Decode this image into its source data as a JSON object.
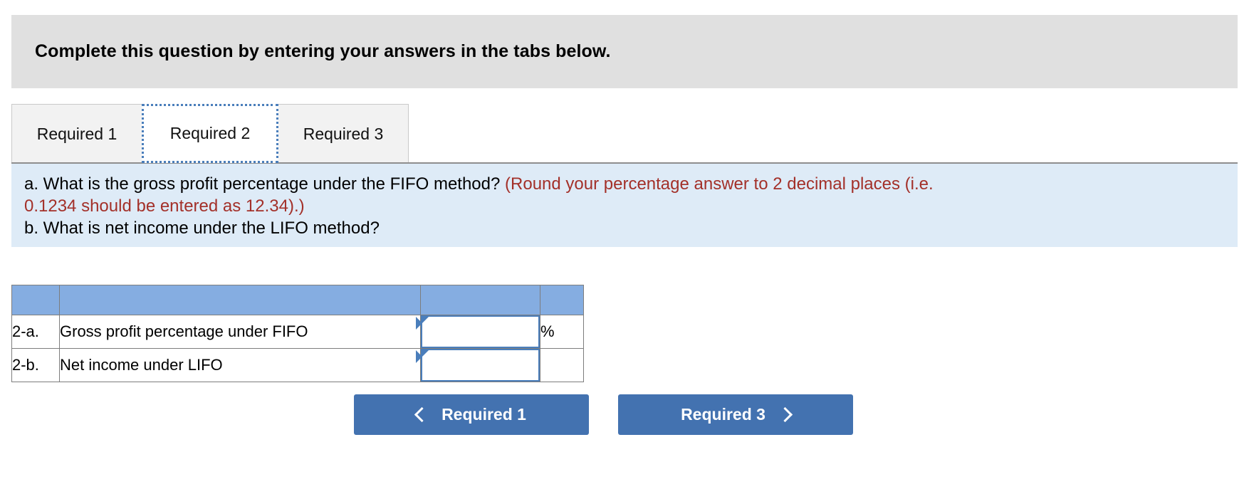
{
  "instruction": {
    "text": "Complete this question by entering your answers in the tabs below."
  },
  "tabs": [
    {
      "label": "Required 1",
      "active": false
    },
    {
      "label": "Required 2",
      "active": true
    },
    {
      "label": "Required 3",
      "active": false
    }
  ],
  "question": {
    "line_a_black": "a. What is the gross profit percentage under the FIFO method? ",
    "line_a_red": "(Round your percentage answer to 2 decimal places (i.e.",
    "line_a_red_cont": "0.1234 should be entered as 12.34).)",
    "line_b": "b. What is net income under the LIFO method?"
  },
  "answer_table": {
    "header": "",
    "rows": [
      {
        "ref": "2-a.",
        "description": "Gross profit percentage under FIFO",
        "value": "",
        "placeholder": "",
        "unit": "%"
      },
      {
        "ref": "2-b.",
        "description": "Net income under LIFO",
        "value": "",
        "placeholder": "",
        "unit": ""
      }
    ]
  },
  "navigation": {
    "prev_label": "Required 1",
    "next_label": "Required 3",
    "prev_icon": "chevron-left-icon",
    "next_icon": "chevron-right-icon"
  },
  "colors": {
    "banner_gray": "#e0e0e0",
    "question_blue": "#deebf7",
    "table_header_blue": "#85ade1",
    "button_blue": "#4372b0",
    "hint_red": "#a33029",
    "focus_blue": "#4a7ebb"
  }
}
